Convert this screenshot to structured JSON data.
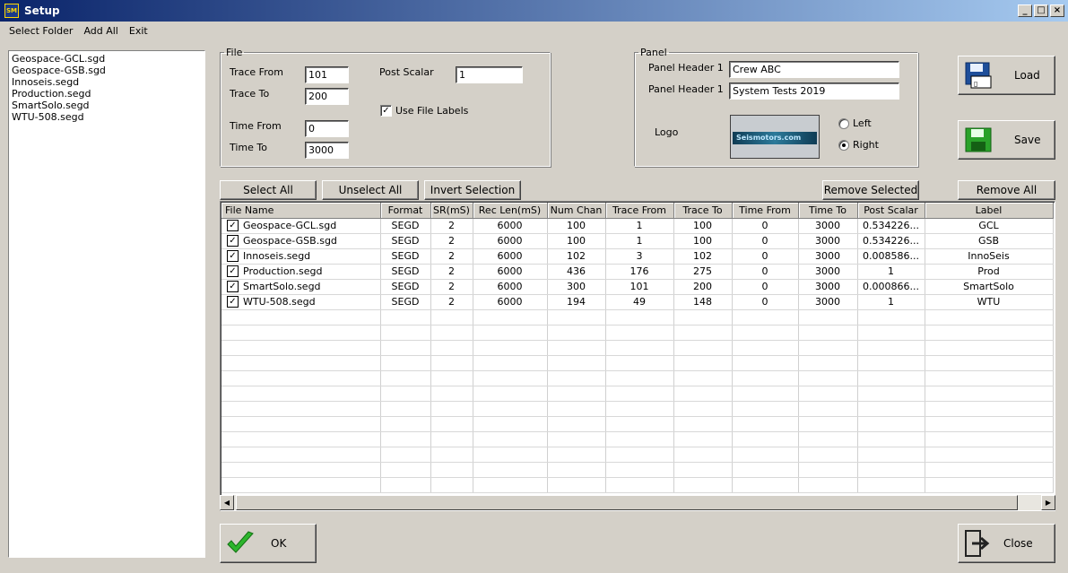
{
  "window": {
    "title": "Setup",
    "icon_text": "SM"
  },
  "menu": [
    "Select Folder",
    "Add All",
    "Exit"
  ],
  "file_list": [
    "Geospace-GCL.sgd",
    "Geospace-GSB.sgd",
    "Innoseis.segd",
    "Production.segd",
    "SmartSolo.segd",
    "WTU-508.segd"
  ],
  "file_group": {
    "legend": "File",
    "trace_from_label": "Trace From",
    "trace_from": "101",
    "trace_to_label": "Trace To",
    "trace_to": "200",
    "time_from_label": "Time From",
    "time_from": "0",
    "time_to_label": "Time To",
    "time_to": "3000",
    "post_scalar_label": "Post Scalar",
    "post_scalar": "1",
    "use_file_labels_label": "Use File Labels",
    "use_file_labels_checked": true
  },
  "panel_group": {
    "legend": "Panel",
    "header1_label": "Panel Header 1",
    "header1": "Crew ABC",
    "header2_label": "Panel Header 1",
    "header2": "System Tests 2019",
    "logo_label": "Logo",
    "logo_text": "Seismotors.com",
    "left_label": "Left",
    "right_label": "Right",
    "selected": "right"
  },
  "buttons": {
    "load": "Load",
    "save": "Save",
    "select_all": "Select All",
    "unselect_all": "Unselect All",
    "invert_selection": "Invert Selection",
    "remove_selected": "Remove Selected",
    "remove_all": "Remove All",
    "ok": "OK",
    "close": "Close"
  },
  "table": {
    "columns": [
      "File Name",
      "Format",
      "SR(mS)",
      "Rec Len(mS)",
      "Num Chan",
      "Trace From",
      "Trace To",
      "Time From",
      "Time To",
      "Post Scalar",
      "Label"
    ],
    "rows": [
      [
        "Geospace-GCL.sgd",
        "SEGD",
        "2",
        "6000",
        "100",
        "1",
        "100",
        "0",
        "3000",
        "0.534226...",
        "GCL"
      ],
      [
        "Geospace-GSB.sgd",
        "SEGD",
        "2",
        "6000",
        "100",
        "1",
        "100",
        "0",
        "3000",
        "0.534226...",
        "GSB"
      ],
      [
        "Innoseis.segd",
        "SEGD",
        "2",
        "6000",
        "102",
        "3",
        "102",
        "0",
        "3000",
        "0.008586...",
        "InnoSeis"
      ],
      [
        "Production.segd",
        "SEGD",
        "2",
        "6000",
        "436",
        "176",
        "275",
        "0",
        "3000",
        "1",
        "Prod"
      ],
      [
        "SmartSolo.segd",
        "SEGD",
        "2",
        "6000",
        "300",
        "101",
        "200",
        "0",
        "3000",
        "0.000866...",
        "SmartSolo"
      ],
      [
        "WTU-508.segd",
        "SEGD",
        "2",
        "6000",
        "194",
        "49",
        "148",
        "0",
        "3000",
        "1",
        "WTU"
      ]
    ],
    "empty_rows": 12
  },
  "colors": {
    "titlebar_start": "#0a246a",
    "titlebar_end": "#a6caf0",
    "face": "#d4d0c8"
  }
}
